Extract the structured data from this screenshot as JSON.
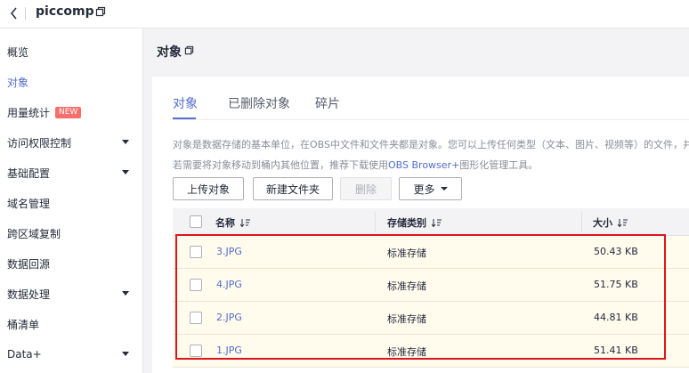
{
  "header": {
    "bucket_name": "piccomp",
    "back_icon": "chevron-left-icon",
    "copy_icon": "copy-icon"
  },
  "sidebar": {
    "items": [
      {
        "label": "概览",
        "active": false
      },
      {
        "label": "对象",
        "active": true
      },
      {
        "label": "用量统计",
        "badge": "NEW"
      },
      {
        "label": "访问权限控制",
        "expandable": true
      },
      {
        "label": "基础配置",
        "expandable": true
      },
      {
        "label": "域名管理"
      },
      {
        "label": "跨区域复制"
      },
      {
        "label": "数据回源"
      },
      {
        "label": "数据处理",
        "expandable": true
      },
      {
        "label": "桶清单"
      },
      {
        "label": "Data+",
        "expandable": true
      }
    ]
  },
  "page": {
    "title": "对象"
  },
  "tabs": [
    {
      "label": "对象",
      "active": true
    },
    {
      "label": "已删除对象",
      "active": false
    },
    {
      "label": "碎片",
      "active": false
    }
  ],
  "description": {
    "line1": "对象是数据存储的基本单位，在OBS中文件和文件夹都是对象。您可以上传任何类型（文本、图片、视频等）的文件，并在",
    "line2_prefix": "若需要将对象移动到桶内其他位置，推荐下载使用",
    "line2_link": "OBS Browser+",
    "line2_suffix": "图形化管理工具。"
  },
  "toolbar": {
    "upload_label": "上传对象",
    "new_folder_label": "新建文件夹",
    "delete_label": "删除",
    "more_label": "更多"
  },
  "table": {
    "columns": [
      "名称",
      "存储类别",
      "大小"
    ],
    "rows": [
      {
        "name": "3.JPG",
        "storage": "标准存储",
        "size": "50.43 KB"
      },
      {
        "name": "4.JPG",
        "storage": "标准存储",
        "size": "51.75 KB"
      },
      {
        "name": "2.JPG",
        "storage": "标准存储",
        "size": "44.81 KB"
      },
      {
        "name": "1.JPG",
        "storage": "标准存储",
        "size": "51.41 KB"
      }
    ]
  },
  "colors": {
    "accent": "#526ecc",
    "highlight": "#e0141c",
    "badge": "#f66f6a",
    "row_bg": "#fffbed"
  }
}
